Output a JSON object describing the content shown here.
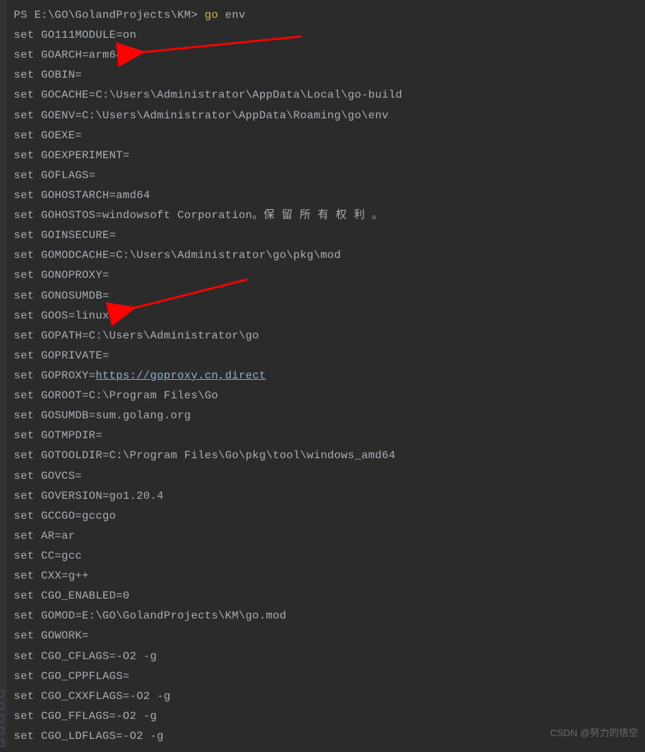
{
  "prompt": {
    "prefix": "PS",
    "path": "E:\\GO\\GolandProjects\\KM>",
    "command": "go",
    "arg": "env"
  },
  "lines": [
    "set GO111MODULE=on",
    "set GOARCH=arm64",
    "set GOBIN=",
    "set GOCACHE=C:\\Users\\Administrator\\AppData\\Local\\go-build",
    "set GOENV=C:\\Users\\Administrator\\AppData\\Roaming\\go\\env",
    "set GOEXE=",
    "set GOEXPERIMENT=",
    "set GOFLAGS=",
    "set GOHOSTARCH=amd64",
    "set GOHOSTOS=windowsoft Corporation。保 留 所 有 权 利 。",
    "set GOINSECURE=",
    "set GOMODCACHE=C:\\Users\\Administrator\\go\\pkg\\mod",
    "set GONOPROXY=",
    "set GONOSUMDB=",
    "set GOOS=linux",
    "set GOPATH=C:\\Users\\Administrator\\go",
    "set GOPRIVATE=",
    "set GOPROXY=",
    "set GOROOT=C:\\Program Files\\Go",
    "set GOSUMDB=sum.golang.org",
    "set GOTMPDIR=",
    "set GOTOOLDIR=C:\\Program Files\\Go\\pkg\\tool\\windows_amd64",
    "set GOVCS=",
    "set GOVERSION=go1.20.4",
    "set GCCGO=gccgo",
    "set AR=ar",
    "set CC=gcc",
    "set CXX=g++",
    "set CGO_ENABLED=0",
    "set GOMOD=E:\\GO\\GolandProjects\\KM\\go.mod",
    "set GOWORK=",
    "set CGO_CFLAGS=-O2 -g",
    "set CGO_CPPFLAGS=",
    "set CGO_CXXFLAGS=-O2 -g",
    "set CGO_FFLAGS=-O2 -g",
    "set CGO_LDFLAGS=-O2 -g"
  ],
  "proxy_url": "https://goproxy.cn,direct",
  "watermark": "CSDN @努力的悟空"
}
